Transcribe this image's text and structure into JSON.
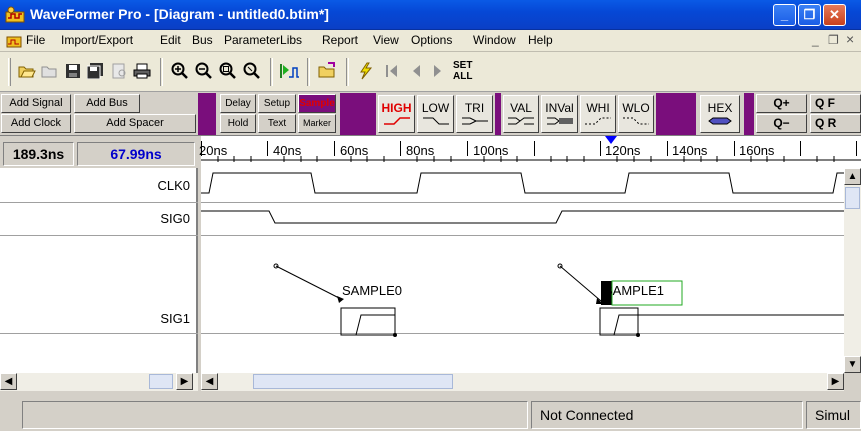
{
  "window": {
    "title": "WaveFormer Pro - [Diagram - untitled0.btim*]",
    "minimize_glyph": "_",
    "restore_glyph": "❐",
    "close_glyph": "✕"
  },
  "menu": {
    "items": [
      "File",
      "Import/Export",
      "Edit",
      "Bus",
      "ParameterLibs",
      "Report",
      "View",
      "Options",
      "Window",
      "Help"
    ],
    "mdi_min": "_",
    "mdi_restore": "❐",
    "mdi_close": "×"
  },
  "toolbar": {
    "set_all_line1": "SET",
    "set_all_line2": "ALL"
  },
  "signal_toolbar": {
    "add_signal": "Add Signal",
    "add_bus": "Add Bus",
    "add_clock": "Add Clock",
    "add_spacer": "Add Spacer",
    "delay": "Delay",
    "setup": "Setup",
    "sample": "Sample",
    "hold": "Hold",
    "text": "Text",
    "marker": "Marker",
    "high": "HIGH",
    "low": "LOW",
    "tri": "TRI",
    "val": "VAL",
    "inval": "INVal",
    "whi": "WHI",
    "wlo": "WLO",
    "hex": "HEX",
    "zoom_in": "Q+",
    "zoom_out": "Q−",
    "zoom_full": "Q F",
    "zoom_range": "Q R"
  },
  "times": {
    "cursor": "189.3ns",
    "delta": "67.99ns"
  },
  "ruler": {
    "labels": [
      "20ns",
      "40ns",
      "60ns",
      "80ns",
      "100ns",
      "120ns",
      "140ns",
      "160ns"
    ]
  },
  "signals": [
    "CLK0",
    "SIG0",
    "SIG1"
  ],
  "annotations": {
    "sample0": "SAMPLE0",
    "sample1": "SAMPLE1"
  },
  "status": {
    "panel1": "",
    "connection": "Not Connected",
    "mode": "Simul"
  },
  "colors": {
    "title_bar": "#0a5ae6",
    "delta_time": "#0000cc",
    "sample_text": "#e00000",
    "high_button": "#e00000",
    "purple_divider": "#7a0e7c",
    "sample1_box": "#22aa22",
    "cursor_marker": "#0000ff"
  }
}
